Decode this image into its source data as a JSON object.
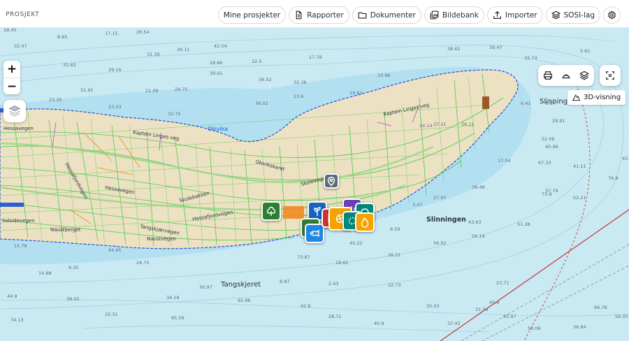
{
  "header": {
    "project_label": "PROSJEKT",
    "nav": [
      {
        "label": "Mine prosjekter",
        "icon": "none"
      },
      {
        "label": "Rapporter",
        "icon": "document-icon"
      },
      {
        "label": "Dokumenter",
        "icon": "folder-icon"
      },
      {
        "label": "Bildebank",
        "icon": "images-icon"
      },
      {
        "label": "Importer",
        "icon": "upload-icon"
      },
      {
        "label": "SOSI-lag",
        "icon": "layers-icon"
      }
    ]
  },
  "map": {
    "zoom_in": "+",
    "zoom_out": "−",
    "btn_3d": "3D-visning",
    "places": {
      "slinningsodden": "Slinningsodden",
      "slinningen": "Slinningen",
      "tangskjeret": "Tangskjeret",
      "olsvika": "Olsvika",
      "hessavegen": "Hessavegen",
      "kaptein_linges_veg": "Kaptein Linges veg",
      "kaptein_linges_veg2": "Kaptein Linges veg",
      "olsvikskaret": "Olsvikskaret",
      "hessaveg2": "Hessavegen",
      "hessafjordvegen": "Hessafjordvegen",
      "skuleta": "Skulebakken",
      "solsidevegen": "Solsidevegen",
      "naustberget": "Naustberget",
      "tangskjaervegen": "Tangskjærvegen",
      "naustvegen": "Naustvegen",
      "hessafjordvegen2": "Hessafjordvegen",
      "skuleveg": "Skolevegen"
    },
    "depths": [
      "18.45",
      "17.15",
      "26.54",
      "8.65",
      "42.54",
      "28.86",
      "32.5",
      "38.61",
      "39.47",
      "32.36",
      "32.47",
      "32.63",
      "31.39",
      "36.11",
      "5.61",
      "17.78",
      "36.52",
      "10.96",
      "29.16",
      "39.61",
      "23.6",
      "32.74",
      "56.4",
      "31.91",
      "21.09",
      "24.75",
      "6.64",
      "23.35",
      "36.02",
      "6.41",
      "23.23",
      "32.75",
      "19.62",
      "29.91",
      "37.31",
      "26.12",
      "52.06",
      "14.14",
      "40.96",
      "41.11",
      "17.54",
      "45.91",
      "67.33",
      "37.79",
      "38.48",
      "27.97",
      "76.9",
      "73.8",
      "52.21",
      "3.47",
      "43.63",
      "51.38",
      "8.59",
      "56.19",
      "56.92",
      "26.51",
      "40.22",
      "8.35",
      "26.75",
      "73.87",
      "64.95",
      "15.78",
      "14.98",
      "18.61",
      "8.87",
      "2.43",
      "22.73",
      "23.71",
      "45.8",
      "30.97",
      "38.02",
      "44.9",
      "34.18",
      "92.86",
      "92.8",
      "35.03",
      "31.56",
      "25.31",
      "40.9",
      "37.43",
      "28.71",
      "63.97",
      "74.13",
      "58.06",
      "36.84",
      "66.76",
      "56.05",
      "65.59",
      "60.49",
      "53.48",
      "25.63",
      "59.47",
      "58.89",
      "96.74",
      "71.97",
      "84.54",
      "50",
      "48.71",
      "46.48",
      "49.81",
      "3.51",
      "2.29",
      "0.81",
      "102",
      "5.38",
      "7.67",
      "97.13"
    ],
    "markers": [
      {
        "name": "tree-marker",
        "color": "#2e7d32"
      },
      {
        "name": "pin-marker",
        "color": "#5d6b78"
      },
      {
        "name": "fish-marker",
        "color": "#1565c0"
      },
      {
        "name": "water-marker",
        "color": "#1e88e5"
      },
      {
        "name": "shell-marker",
        "color": "#f4a300"
      },
      {
        "name": "fire-marker",
        "color": "#f4a300"
      },
      {
        "name": "circle-marker",
        "color": "#00897b"
      },
      {
        "name": "purple-marker",
        "color": "#6a3fb5"
      }
    ],
    "colors": {
      "water": "#c6e8f2",
      "deep_water": "#d7eef6",
      "land": "#ede3c7",
      "forest_lines": "#35c93a",
      "roads": "#d6c89a"
    }
  }
}
